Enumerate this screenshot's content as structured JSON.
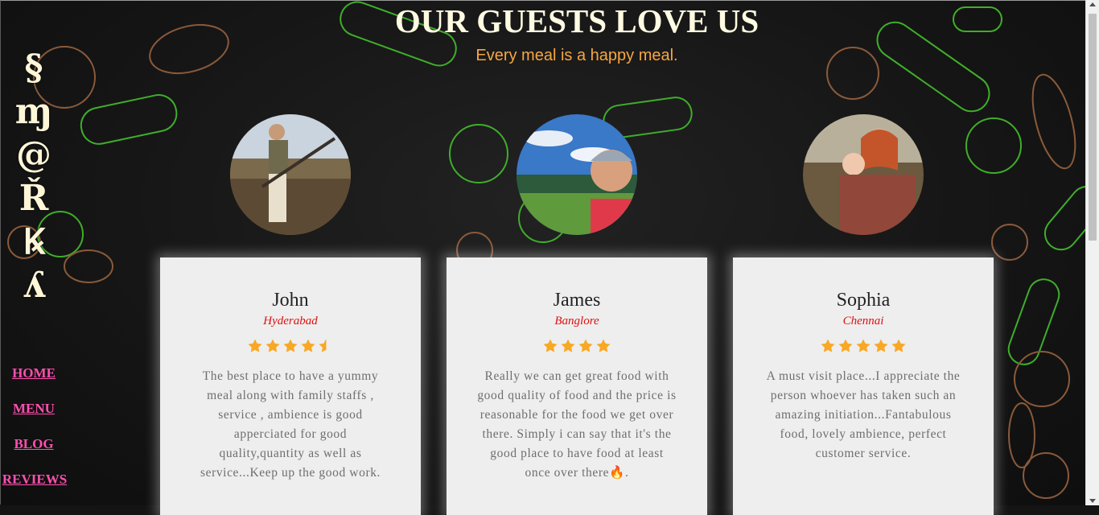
{
  "logo": {
    "glyphs": [
      "§",
      "ɱ",
      "@",
      "Ř",
      "Ꝃ",
      "ʎ"
    ]
  },
  "nav": {
    "items": [
      "HOME",
      "MENU",
      "BLOG",
      "REVIEWS"
    ]
  },
  "header": {
    "title": "OUR GUESTS LOVE US",
    "subtitle": "Every meal is a happy meal."
  },
  "colors": {
    "accent_orange": "#f7a640",
    "nav_pink": "#ff4fb0",
    "city_red": "#dd1010",
    "star": "#f9a825",
    "card_bg": "#eeeeee"
  },
  "reviews": [
    {
      "name": "John",
      "city": "Hyderabad",
      "rating": 4.5,
      "text": "The best place to have a yummy meal along with family staffs , service , ambience is good apperciated for good quality,quantity as well as service...Keep up the good work."
    },
    {
      "name": "James",
      "city": "Banglore",
      "rating": 4,
      "text": "Really we can get great food with good quality of food and the price is reasonable for the food we get over there. Simply i can say that it's the good place to have food at least once over there🔥."
    },
    {
      "name": "Sophia",
      "city": "Chennai",
      "rating": 5,
      "text": "A must visit place...I appreciate the person whoever has taken such an amazing initiation...Fantabulous food, lovely ambience, perfect customer service."
    }
  ]
}
